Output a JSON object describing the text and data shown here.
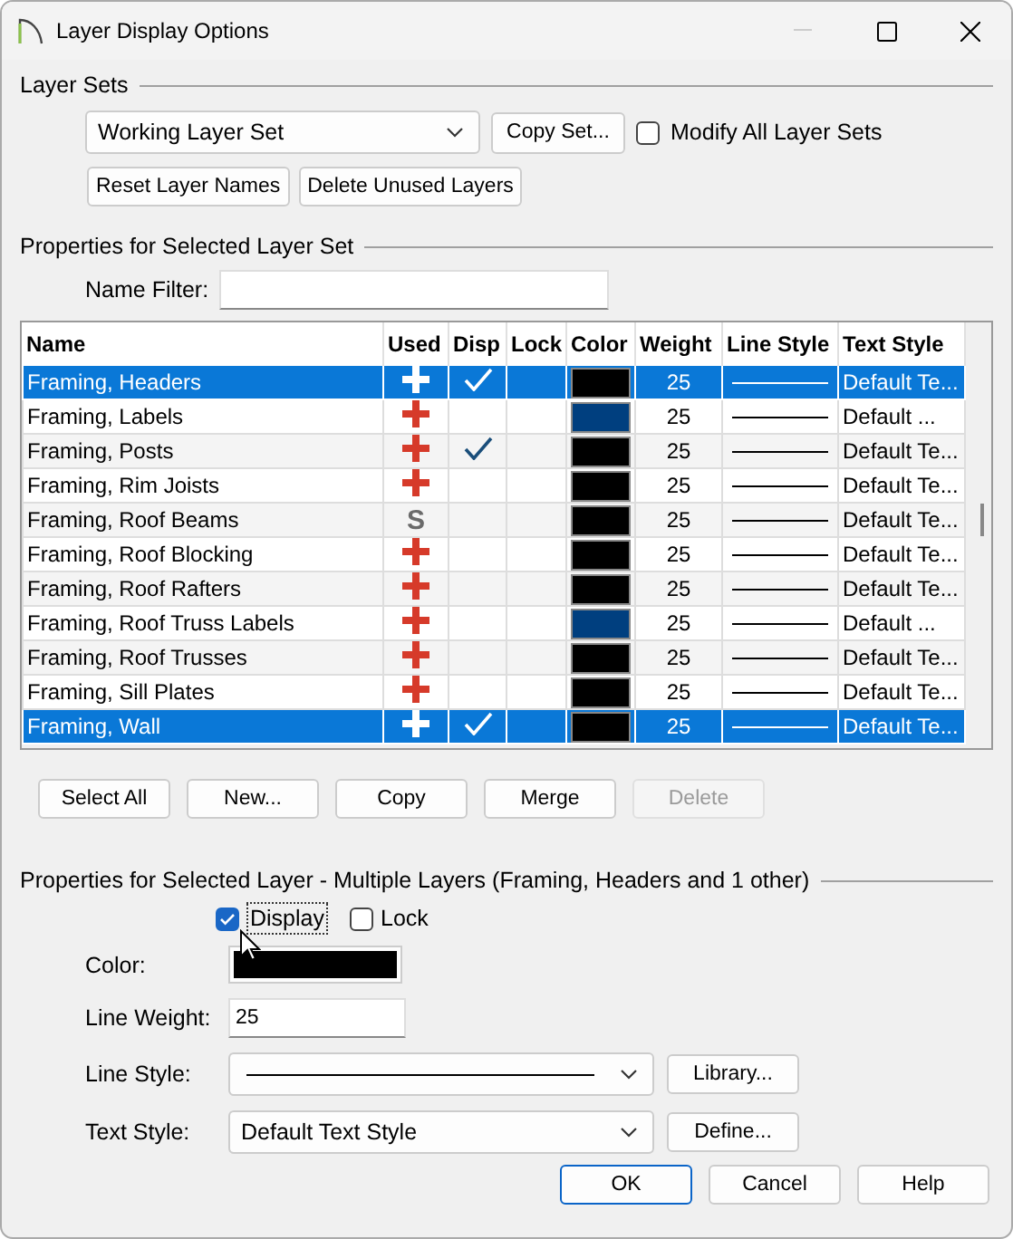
{
  "window": {
    "title": "Layer Display Options"
  },
  "layer_sets": {
    "heading": "Layer Sets",
    "set_dropdown": "Working Layer Set",
    "copy_button": "Copy Set...",
    "modify_all": {
      "label": "Modify All Layer Sets",
      "checked": false
    },
    "buttons": [
      "Reset Layer Names",
      "Delete Unused Layers"
    ]
  },
  "set_properties": {
    "heading": "Properties for Selected Layer Set",
    "name_filter_label": "Name Filter:"
  },
  "table": {
    "columns": [
      "Name",
      "Used",
      "Disp",
      "Lock",
      "Color",
      "Weight",
      "Line Style",
      "Text Style"
    ],
    "rows": [
      {
        "name": "Framing, Headers",
        "used": {
          "kind": "plus"
        },
        "disp": true,
        "color": "#000000",
        "weight": "25",
        "text_style": "Default Te...",
        "selected": true
      },
      {
        "name": "Framing, Labels",
        "used": {
          "kind": "plus"
        },
        "disp": false,
        "color": "#003f7f",
        "weight": "25",
        "text_style": "Default ...",
        "selected": false
      },
      {
        "name": "Framing, Posts",
        "used": {
          "kind": "plus"
        },
        "disp": true,
        "color": "#000000",
        "weight": "25",
        "text_style": "Default Te...",
        "selected": false
      },
      {
        "name": "Framing, Rim Joists",
        "used": {
          "kind": "plus"
        },
        "disp": false,
        "color": "#000000",
        "weight": "25",
        "text_style": "Default Te...",
        "selected": false
      },
      {
        "name": "Framing, Roof Beams",
        "used": {
          "kind": "letter",
          "text": "S"
        },
        "disp": false,
        "color": "#000000",
        "weight": "25",
        "text_style": "Default Te...",
        "selected": false
      },
      {
        "name": "Framing, Roof Blocking",
        "used": {
          "kind": "plus"
        },
        "disp": false,
        "color": "#000000",
        "weight": "25",
        "text_style": "Default Te...",
        "selected": false
      },
      {
        "name": "Framing, Roof Rafters",
        "used": {
          "kind": "plus"
        },
        "disp": false,
        "color": "#000000",
        "weight": "25",
        "text_style": "Default Te...",
        "selected": false
      },
      {
        "name": "Framing, Roof Truss Labels",
        "used": {
          "kind": "plus"
        },
        "disp": false,
        "color": "#003f7f",
        "weight": "25",
        "text_style": "Default ...",
        "selected": false
      },
      {
        "name": "Framing, Roof Trusses",
        "used": {
          "kind": "plus"
        },
        "disp": false,
        "color": "#000000",
        "weight": "25",
        "text_style": "Default Te...",
        "selected": false
      },
      {
        "name": "Framing, Sill Plates",
        "used": {
          "kind": "plus"
        },
        "disp": false,
        "color": "#000000",
        "weight": "25",
        "text_style": "Default Te...",
        "selected": false
      },
      {
        "name": "Framing, Wall",
        "used": {
          "kind": "plus"
        },
        "disp": true,
        "color": "#000000",
        "weight": "25",
        "text_style": "Default Te...",
        "selected": true
      }
    ]
  },
  "table_buttons": [
    {
      "label": "Select All",
      "disabled": false
    },
    {
      "label": "New...",
      "disabled": false
    },
    {
      "label": "Copy",
      "disabled": false
    },
    {
      "label": "Merge",
      "disabled": false
    },
    {
      "label": "Delete",
      "disabled": true
    }
  ],
  "layer_properties": {
    "heading": "Properties for Selected Layer - Multiple Layers (Framing, Headers and 1 other)",
    "display": {
      "label": "Display",
      "checked": true
    },
    "lock": {
      "label": "Lock",
      "checked": false
    },
    "color_label": "Color:",
    "color": "#000000",
    "line_weight_label": "Line Weight:",
    "line_weight": "25",
    "line_style_label": "Line Style:",
    "library_button": "Library...",
    "text_style_label": "Text Style:",
    "text_style": "Default Text Style",
    "define_button": "Define..."
  },
  "buttons": [
    "OK",
    "Cancel",
    "Help"
  ]
}
